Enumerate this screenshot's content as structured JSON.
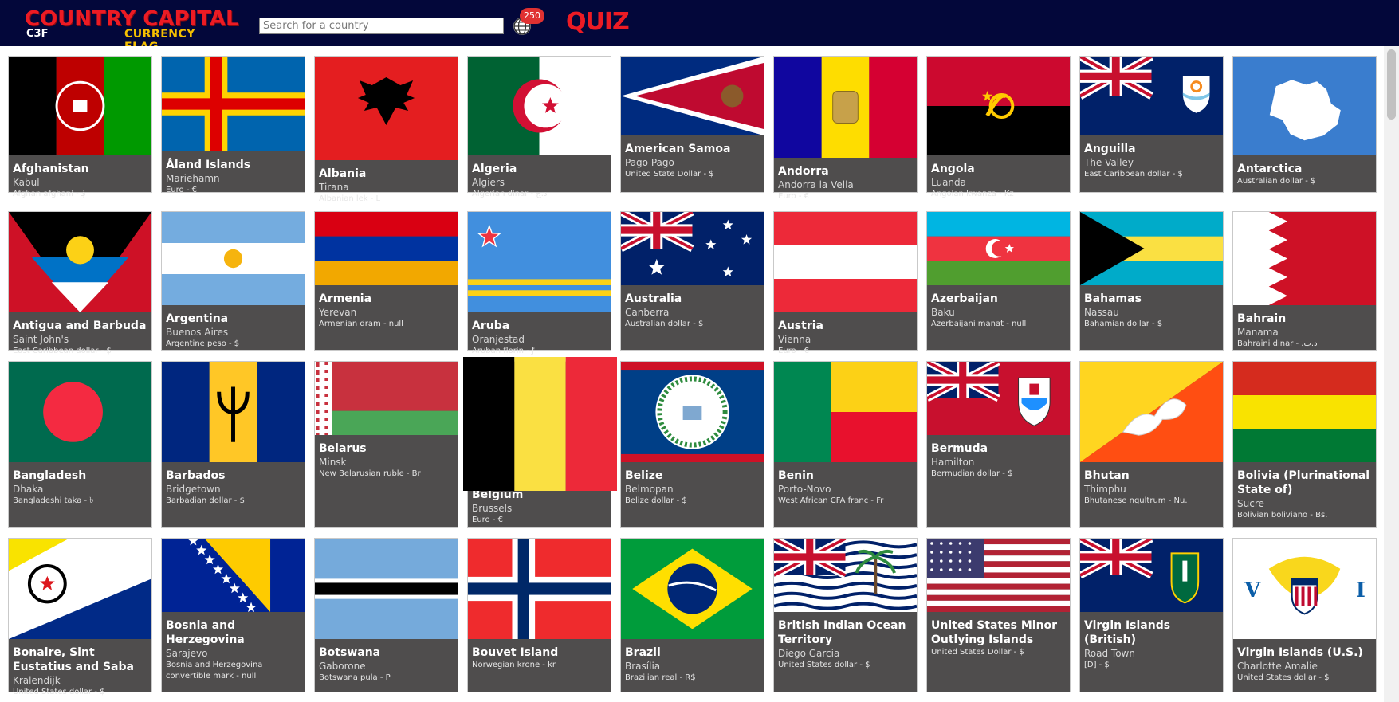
{
  "header": {
    "logo": {
      "line1": "COUNTRY CAPITAL",
      "line2": "C3F",
      "line3": "CURRENCY FLAG"
    },
    "search_placeholder": "Search for a country",
    "count_badge": "250",
    "quiz_label": "QUIZ",
    "globe_icon": "globe-icon"
  },
  "countries": [
    {
      "name": "Afghanistan",
      "capital": "Kabul",
      "currency": "Afghan afghani - ؋"
    },
    {
      "name": "Åland Islands",
      "capital": "Mariehamn",
      "currency": "Euro - €"
    },
    {
      "name": "Albania",
      "capital": "Tirana",
      "currency": "Albanian lek - L"
    },
    {
      "name": "Algeria",
      "capital": "Algiers",
      "currency": "Algerian dinar - د.ج"
    },
    {
      "name": "American Samoa",
      "capital": "Pago Pago",
      "currency": "United State Dollar - $"
    },
    {
      "name": "Andorra",
      "capital": "Andorra la Vella",
      "currency": "Euro - €"
    },
    {
      "name": "Angola",
      "capital": "Luanda",
      "currency": "Angolan kwanza - Kz"
    },
    {
      "name": "Anguilla",
      "capital": "The Valley",
      "currency": "East Caribbean dollar - $"
    },
    {
      "name": "Antarctica",
      "capital": "",
      "currency": "Australian dollar - $"
    },
    {
      "name": "Antigua and Barbuda",
      "capital": "Saint John's",
      "currency": "East Caribbean dollar - $"
    },
    {
      "name": "Argentina",
      "capital": "Buenos Aires",
      "currency": "Argentine peso - $"
    },
    {
      "name": "Armenia",
      "capital": "Yerevan",
      "currency": "Armenian dram - null"
    },
    {
      "name": "Aruba",
      "capital": "Oranjestad",
      "currency": "Aruban florin - ƒ"
    },
    {
      "name": "Australia",
      "capital": "Canberra",
      "currency": "Australian dollar - $"
    },
    {
      "name": "Austria",
      "capital": "Vienna",
      "currency": "Euro - €"
    },
    {
      "name": "Azerbaijan",
      "capital": "Baku",
      "currency": "Azerbaijani manat - null"
    },
    {
      "name": "Bahamas",
      "capital": "Nassau",
      "currency": "Bahamian dollar - $"
    },
    {
      "name": "Bahrain",
      "capital": "Manama",
      "currency": "Bahraini dinar - .د.ب"
    },
    {
      "name": "Bangladesh",
      "capital": "Dhaka",
      "currency": "Bangladeshi taka - ৳"
    },
    {
      "name": "Barbados",
      "capital": "Bridgetown",
      "currency": "Barbadian dollar - $"
    },
    {
      "name": "Belarus",
      "capital": "Minsk",
      "currency": "New Belarusian ruble - Br"
    },
    {
      "name": "Belgium",
      "capital": "Brussels",
      "currency": "Euro - €"
    },
    {
      "name": "Belize",
      "capital": "Belmopan",
      "currency": "Belize dollar - $"
    },
    {
      "name": "Benin",
      "capital": "Porto-Novo",
      "currency": "West African CFA franc - Fr"
    },
    {
      "name": "Bermuda",
      "capital": "Hamilton",
      "currency": "Bermudian dollar - $"
    },
    {
      "name": "Bhutan",
      "capital": "Thimphu",
      "currency": "Bhutanese ngultrum - Nu."
    },
    {
      "name": "Bolivia (Plurinational State of)",
      "capital": "Sucre",
      "currency": "Bolivian boliviano - Bs."
    },
    {
      "name": "Bonaire, Sint Eustatius and Saba",
      "capital": "Kralendijk",
      "currency": "United States dollar - $"
    },
    {
      "name": "Bosnia and Herzegovina",
      "capital": "Sarajevo",
      "currency": "Bosnia and Herzegovina convertible mark - null"
    },
    {
      "name": "Botswana",
      "capital": "Gaborone",
      "currency": "Botswana pula - P"
    },
    {
      "name": "Bouvet Island",
      "capital": "",
      "currency": "Norwegian krone - kr"
    },
    {
      "name": "Brazil",
      "capital": "Brasília",
      "currency": "Brazilian real - R$"
    },
    {
      "name": "British Indian Ocean Territory",
      "capital": "Diego Garcia",
      "currency": "United States dollar - $"
    },
    {
      "name": "United States Minor Outlying Islands",
      "capital": "",
      "currency": "United States Dollar - $"
    },
    {
      "name": "Virgin Islands (British)",
      "capital": "Road Town",
      "currency": "[D] - $"
    },
    {
      "name": "Virgin Islands (U.S.)",
      "capital": "Charlotte Amalie",
      "currency": "United States dollar - $"
    }
  ]
}
